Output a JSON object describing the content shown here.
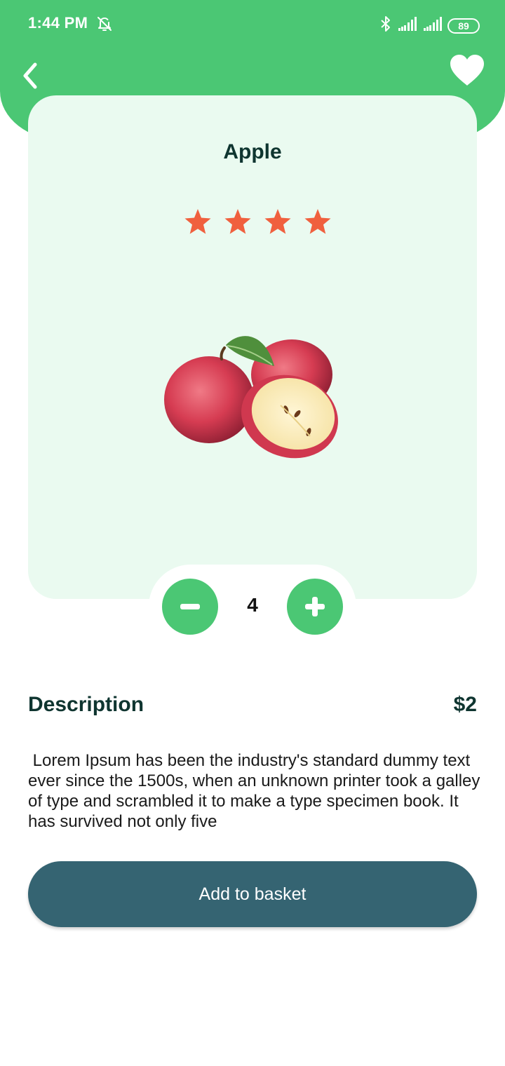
{
  "status_bar": {
    "time": "1:44 PM",
    "battery": "89",
    "icons": [
      "bell-off-icon",
      "bluetooth-icon",
      "signal-icon",
      "signal-icon",
      "battery-icon"
    ]
  },
  "header": {
    "back_icon": "chevron-left-icon",
    "favorite_icon": "heart-icon"
  },
  "product": {
    "name": "Apple",
    "rating": 4,
    "image": "apples-photo",
    "quantity": "4",
    "price": "$2"
  },
  "description": {
    "title": "Description",
    "text": " Lorem Ipsum has been the industry's standard dummy text ever since the 1500s, when an unknown printer took a galley of type and scrambled it to make a type specimen book. It has survived not only five"
  },
  "actions": {
    "add_to_basket": "Add to basket"
  },
  "colors": {
    "primary_green": "#4bc774",
    "card_bg": "#eafaf0",
    "star": "#f0603e",
    "heading": "#0f3530",
    "button": "#356472"
  }
}
